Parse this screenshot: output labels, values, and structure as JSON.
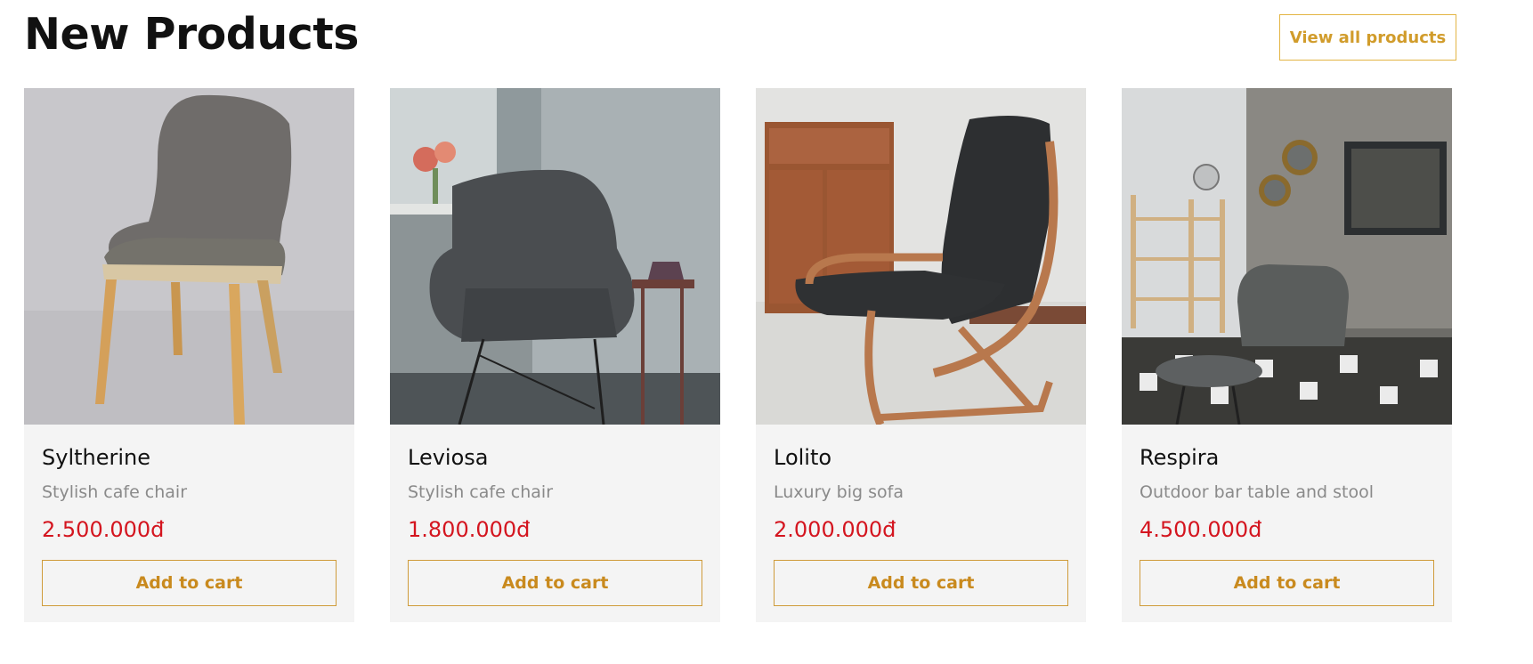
{
  "section": {
    "title": "New Products",
    "view_all_label": "View all products"
  },
  "products": [
    {
      "name": "Syltherine",
      "description": "Stylish cafe chair",
      "price": "2.500.000đ",
      "cta_label": "Add to cart",
      "image_icon": "chair-photo"
    },
    {
      "name": "Leviosa",
      "description": "Stylish cafe chair",
      "price": "1.800.000đ",
      "cta_label": "Add to cart",
      "image_icon": "armchair-photo"
    },
    {
      "name": "Lolito",
      "description": "Luxury big sofa",
      "price": "2.000.000đ",
      "cta_label": "Add to cart",
      "image_icon": "lounge-chair-photo"
    },
    {
      "name": "Respira",
      "description": "Outdoor bar table and stool",
      "price": "4.500.000đ",
      "cta_label": "Add to cart",
      "image_icon": "living-room-photo"
    }
  ],
  "colors": {
    "accent": "#d19c2b",
    "price": "#d4151f",
    "card_bg": "#f4f4f4",
    "muted_text": "#8a8a8a"
  }
}
